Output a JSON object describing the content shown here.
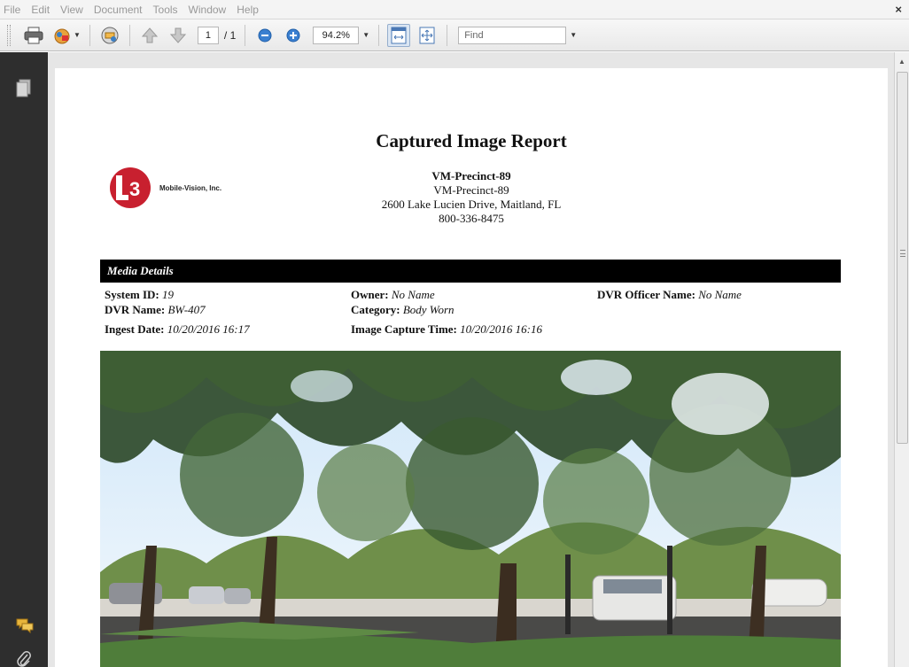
{
  "menu": {
    "items": [
      "File",
      "Edit",
      "View",
      "Document",
      "Tools",
      "Window",
      "Help"
    ],
    "close_glyph": "×"
  },
  "toolbar": {
    "print_icon": "printer-icon",
    "create_icon": "create-pdf-icon",
    "collaborate_icon": "collaborate-icon",
    "prev_icon": "up-arrow-icon",
    "next_icon": "down-arrow-icon",
    "page_current": "1",
    "page_total": "/ 1",
    "zoom_out_icon": "zoom-out-icon",
    "zoom_in_icon": "zoom-in-icon",
    "zoom_value": "94.2%",
    "fit_width_icon": "fit-width-icon",
    "fit_page_icon": "fit-page-icon",
    "find_placeholder": "Find"
  },
  "left_pane": {
    "icons": [
      "pages-icon",
      "comments-icon",
      "attachments-icon"
    ]
  },
  "report": {
    "title": "Captured Image Report",
    "logo_text": "Mobile-Vision, Inc.",
    "logo_monogram": "L3",
    "org_name": "VM-Precinct-89",
    "org_sub": "VM-Precinct-89",
    "address": "2600 Lake Lucien Drive, Maitland, FL",
    "phone": "800-336-8475",
    "section_title": "Media Details",
    "details": {
      "system_id_label": "System ID:",
      "system_id": "19",
      "dvr_name_label": "DVR Name:",
      "dvr_name": "BW-407",
      "ingest_date_label": "Ingest Date:",
      "ingest_date": "10/20/2016 16:17",
      "owner_label": "Owner:",
      "owner": "No Name",
      "category_label": "Category:",
      "category": "Body Worn",
      "capture_time_label": "Image Capture Time:",
      "capture_time": "10/20/2016 16:16",
      "dvr_officer_label": "DVR Officer Name:",
      "dvr_officer": "No Name"
    }
  },
  "colors": {
    "logo_red": "#c8202f",
    "section_bar": "#000000",
    "left_pane": "#2e2e2e"
  }
}
